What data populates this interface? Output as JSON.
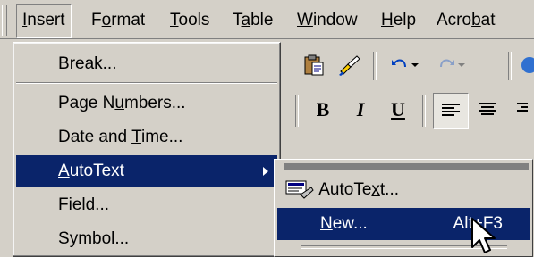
{
  "menubar": {
    "items": [
      {
        "pre": "",
        "acc": "I",
        "post": "nsert"
      },
      {
        "pre": "F",
        "acc": "o",
        "post": "rmat"
      },
      {
        "pre": "",
        "acc": "T",
        "post": "ools"
      },
      {
        "pre": "T",
        "acc": "a",
        "post": "ble"
      },
      {
        "pre": "",
        "acc": "W",
        "post": "indow"
      },
      {
        "pre": "",
        "acc": "H",
        "post": "elp"
      },
      {
        "pre": "Acro",
        "acc": "b",
        "post": "at"
      }
    ]
  },
  "insert_menu": {
    "items": [
      {
        "pre": "",
        "acc": "B",
        "post": "reak..."
      },
      {
        "pre": "Page N",
        "acc": "u",
        "post": "mbers..."
      },
      {
        "pre": "Date and ",
        "acc": "T",
        "post": "ime..."
      },
      {
        "pre": "",
        "acc": "A",
        "post": "utoText"
      },
      {
        "pre": "",
        "acc": "F",
        "post": "ield..."
      },
      {
        "pre": "",
        "acc": "S",
        "post": "ymbol..."
      }
    ]
  },
  "autotext_submenu": {
    "items": [
      {
        "pre": "AutoTe",
        "acc": "x",
        "post": "t...",
        "shortcut": ""
      },
      {
        "pre": "",
        "acc": "N",
        "post": "ew...",
        "shortcut": "Alt+F3"
      }
    ]
  },
  "toolbar": {
    "bold": "B",
    "italic": "I",
    "underline": "U"
  },
  "colors": {
    "face": "#d4d0c8",
    "highlight": "#0a246a",
    "highlight_text": "#ffffff"
  }
}
